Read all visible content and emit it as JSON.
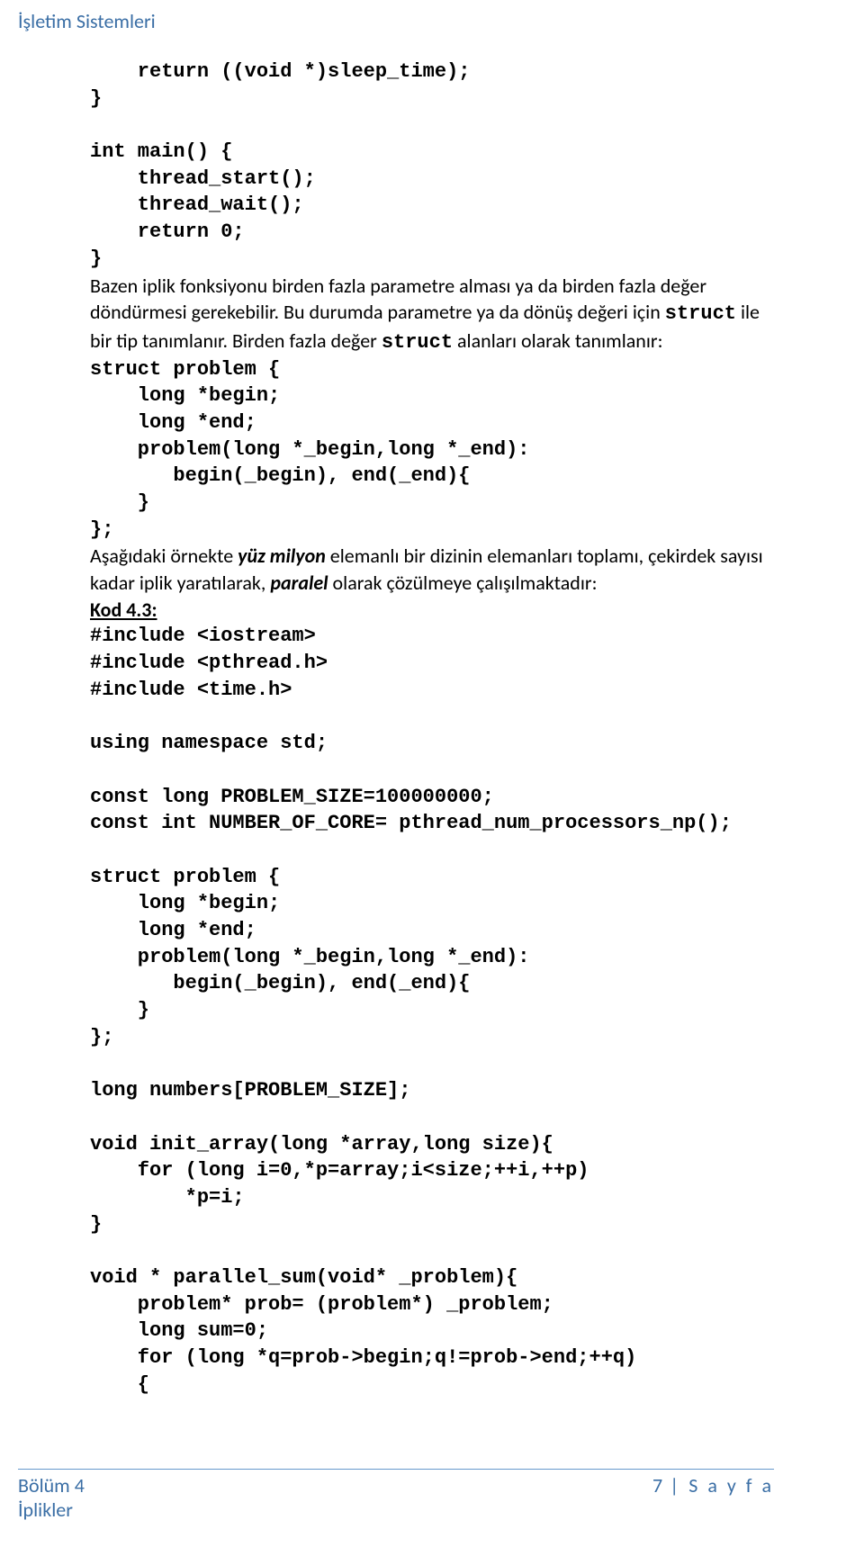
{
  "header": "İşletim Sistemleri",
  "code1": "    return ((void *)sleep_time);\n}\n\nint main() {\n    thread_start();\n    thread_wait();\n    return 0;\n}",
  "prose1a": "Bazen iplik fonksiyonu birden fazla parametre alması ya da birden fazla değer döndürmesi gerekebilir. Bu durumda parametre ya da dönüş değeri için ",
  "prose1b": "struct",
  "prose1c": " ile bir tip tanımlanır. Birden fazla değer ",
  "prose1d": "struct",
  "prose1e": " alanları olarak tanımlanır:",
  "code2": "struct problem {\n    long *begin;\n    long *end;\n    problem(long *_begin,long *_end):\n       begin(_begin), end(_end){\n    }\n};",
  "prose2a": "Aşağıdaki örnekte ",
  "prose2b": "yüz milyon",
  "prose2c": " elemanlı bir dizinin elemanları toplamı, çekirdek sayısı kadar iplik yaratılarak, ",
  "prose2d": "paralel",
  "prose2e": " olarak çözülmeye çalışılmaktadır:",
  "kod_label": "Kod 4.3:",
  "code3": "#include <iostream>\n#include <pthread.h>\n#include <time.h>\n\nusing namespace std;\n\nconst long PROBLEM_SIZE=100000000;\nconst int NUMBER_OF_CORE= pthread_num_processors_np();\n\nstruct problem {\n    long *begin;\n    long *end;\n    problem(long *_begin,long *_end):\n       begin(_begin), end(_end){\n    }\n};\n\nlong numbers[PROBLEM_SIZE];\n\nvoid init_array(long *array,long size){\n    for (long i=0,*p=array;i<size;++i,++p)\n        *p=i;\n}\n\nvoid * parallel_sum(void* _problem){\n    problem* prob= (problem*) _problem;\n    long sum=0;\n    for (long *q=prob->begin;q!=prob->end;++q)\n    {",
  "footer": {
    "chapter": "Bölüm 4",
    "topic": "İplikler",
    "page_num": "7",
    "page_word": "S a y f a"
  }
}
